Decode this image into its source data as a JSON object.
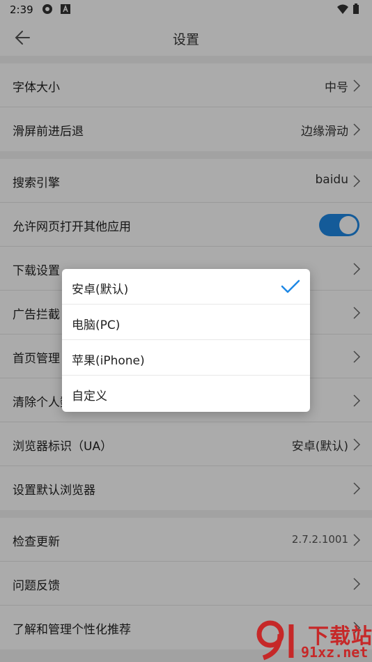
{
  "status": {
    "time": "2:39",
    "icons": [
      "sync-icon",
      "a-icon",
      "wifi-icon",
      "battery-icon"
    ]
  },
  "header": {
    "title": "设置"
  },
  "groups": [
    {
      "rows": [
        {
          "label": "字体大小",
          "value": "中号"
        },
        {
          "label": "滑屏前进后退",
          "value": "边缘滑动"
        }
      ]
    },
    {
      "rows": [
        {
          "label": "搜索引擎",
          "value": "baidu"
        },
        {
          "label": "允许网页打开其他应用",
          "toggle": true
        },
        {
          "label": "下载设置",
          "value": ""
        },
        {
          "label": "广告拦截",
          "value": ""
        },
        {
          "label": "首页管理",
          "value": ""
        },
        {
          "label": "清除个人数据",
          "value": ""
        },
        {
          "label": "浏览器标识（UA）",
          "value": "安卓(默认)"
        },
        {
          "label": "设置默认浏览器",
          "value": ""
        }
      ]
    },
    {
      "rows": [
        {
          "label": "检查更新",
          "value": "2.7.2.1001"
        },
        {
          "label": "问题反馈",
          "value": ""
        },
        {
          "label": "了解和管理个性化推荐",
          "value": ""
        }
      ]
    }
  ],
  "ua_menu": {
    "options": [
      "安卓(默认)",
      "电脑(PC)",
      "苹果(iPhone)",
      "自定义"
    ],
    "selected": "安卓(默认)"
  },
  "watermark": {
    "line1": "下载站",
    "line2": "91xz.net"
  },
  "colors": {
    "accent": "#1e88e5",
    "watermark": "#c62828"
  }
}
